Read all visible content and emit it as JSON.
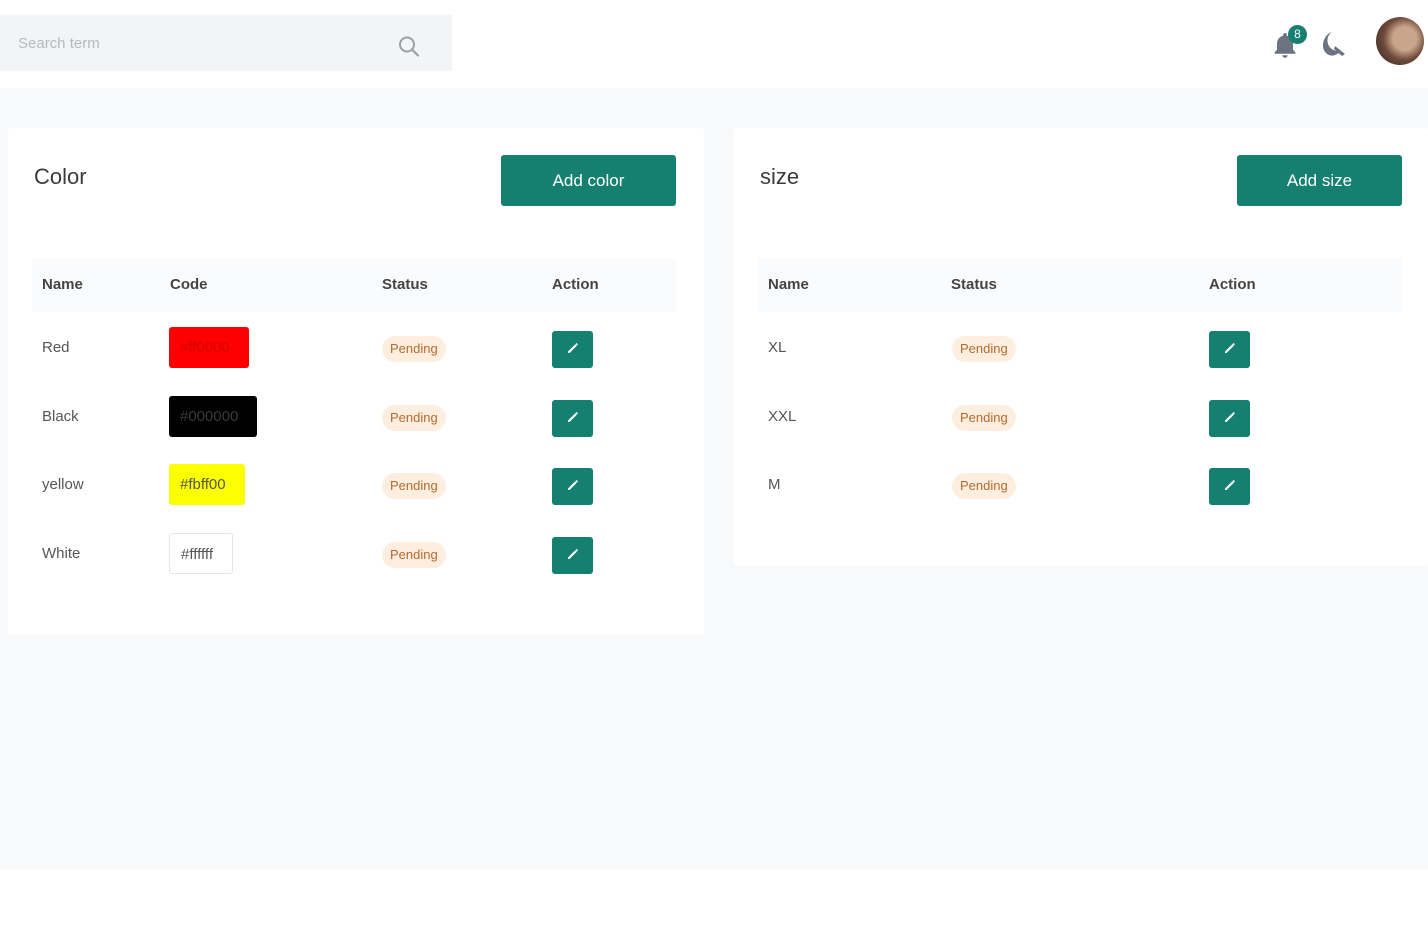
{
  "header": {
    "search_placeholder": "Search term",
    "notification_count": "8"
  },
  "color_card": {
    "title": "Color",
    "add_button_label": "Add color",
    "columns": [
      "Name",
      "Code",
      "Status",
      "Action"
    ],
    "rows": [
      {
        "name": "Red",
        "code": "#ff0000",
        "status": "Pending"
      },
      {
        "name": "Black",
        "code": "#000000",
        "status": "Pending"
      },
      {
        "name": "yellow",
        "code": "#fbff00",
        "status": "Pending"
      },
      {
        "name": "White",
        "code": "#ffffff",
        "status": "Pending"
      }
    ]
  },
  "size_card": {
    "title": "size",
    "add_button_label": "Add size",
    "columns": [
      "Name",
      "Status",
      "Action"
    ],
    "rows": [
      {
        "name": "XL",
        "status": "Pending"
      },
      {
        "name": "XXL",
        "status": "Pending"
      },
      {
        "name": "M",
        "status": "Pending"
      }
    ]
  },
  "colors": {
    "accent": "#15806f",
    "pending_bg": "#fdeee0",
    "pending_text": "#b86a2c"
  },
  "icons": {
    "search": "search-icon",
    "notifications": "bell-icon",
    "theme": "moon-icon",
    "edit": "pencil-icon"
  }
}
